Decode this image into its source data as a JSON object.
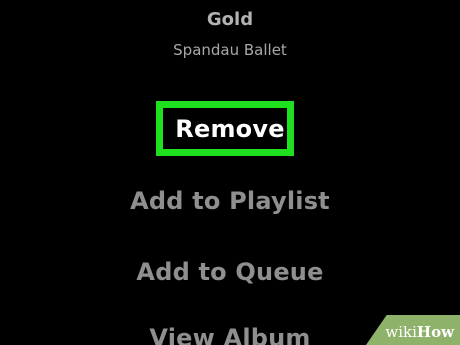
{
  "track": {
    "title": "Gold",
    "artist": "Spandau Ballet"
  },
  "menu": {
    "items": [
      {
        "label": "Remove",
        "highlighted": true
      },
      {
        "label": "Add to Playlist"
      },
      {
        "label": "Add to Queue"
      },
      {
        "label": "View Album"
      }
    ]
  },
  "highlight": {
    "color": "#1fe01f"
  },
  "watermark": {
    "wiki": "wiki",
    "how": "How"
  },
  "colors": {
    "background": "#000000",
    "menu_text": "#8f8f8f",
    "highlighted_text": "#ffffff",
    "watermark_bg": "#8fb26b"
  }
}
